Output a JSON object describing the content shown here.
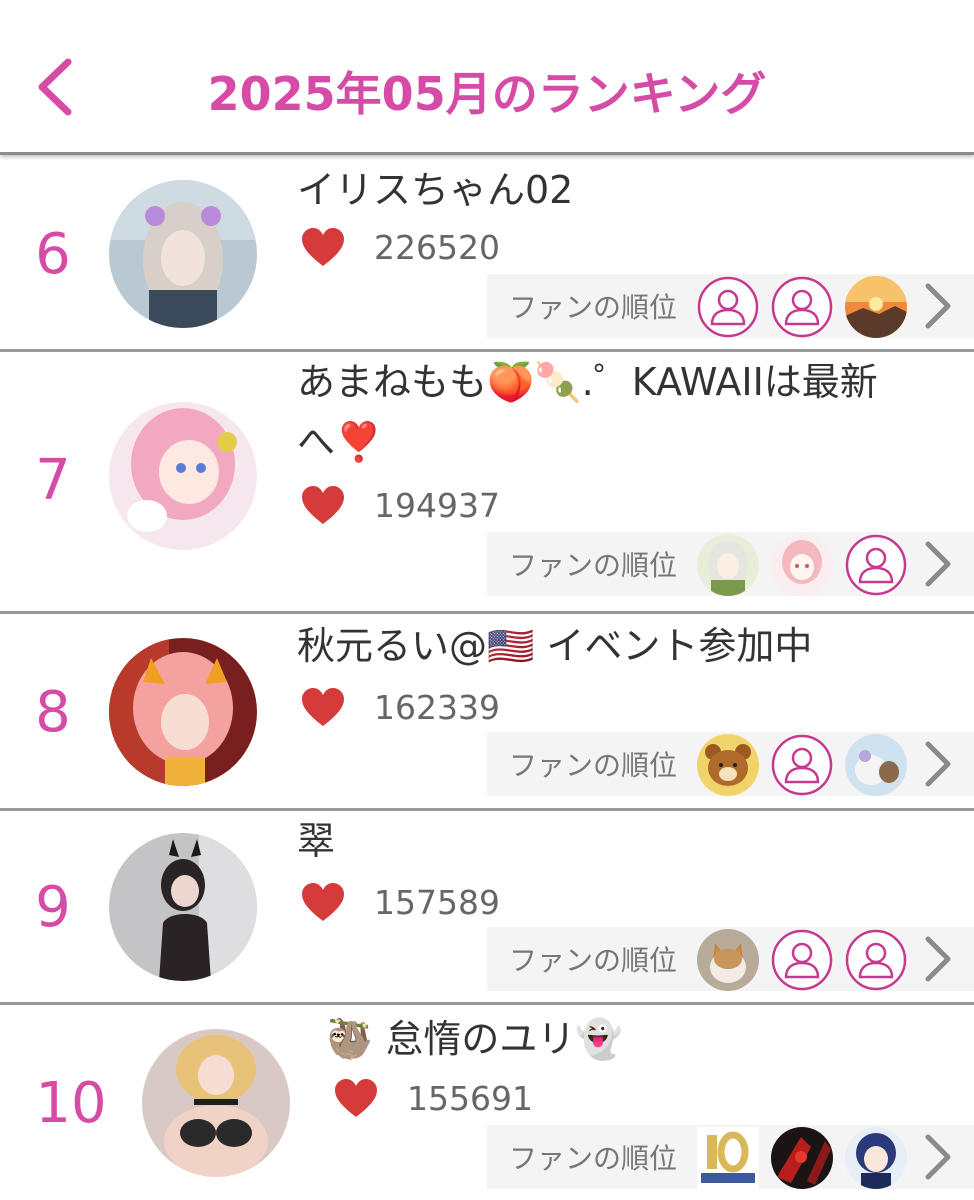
{
  "header": {
    "title": "2025年05月のランキング",
    "back_icon": "chevron-left-icon",
    "accent_color": "#d64ba6"
  },
  "fans_label": "ファンの順位",
  "rows": [
    {
      "rank": "6",
      "name": "イリスちゃん02",
      "likes": "226520",
      "fans": [
        "default-user-icon",
        "default-user-icon",
        "sunset-photo"
      ]
    },
    {
      "rank": "7",
      "name": "あまねもも🍑🍡.゜KAWAIIは最新へ❣️",
      "likes": "194937",
      "fans": [
        "anime-girl-photo",
        "pink-sketch-photo",
        "default-user-icon"
      ]
    },
    {
      "rank": "8",
      "name": "秋元るい@🇺🇸 イベント参加中",
      "likes": "162339",
      "fans": [
        "bear-photo",
        "default-user-icon",
        "plush-photo"
      ]
    },
    {
      "rank": "9",
      "name": "翠",
      "likes": "157589",
      "fans": [
        "cat-photo",
        "default-user-icon",
        "default-user-icon"
      ]
    },
    {
      "rank": "10",
      "name": "🦥 怠惰のユリ👻",
      "likes": "155691",
      "fans": [
        "anniversary-logo-photo",
        "red-art-photo",
        "anime-boy-photo"
      ]
    }
  ]
}
